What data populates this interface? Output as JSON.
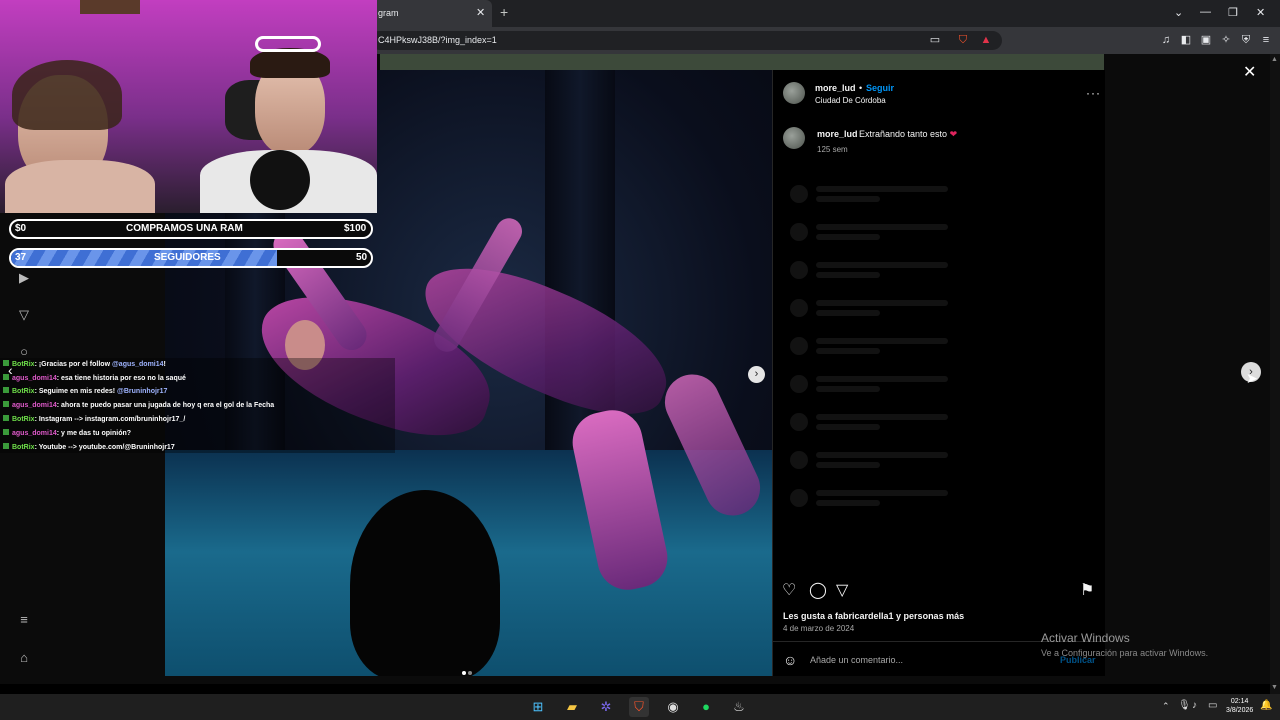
{
  "browser": {
    "tab_title": "gram",
    "url": "C4HPkswJ38B/?img_index=1"
  },
  "post": {
    "username": "more_lud",
    "follow": "Seguir",
    "location": "Ciudad De Córdoba",
    "caption_user": "more_lud",
    "caption_text": "Extrañando tanto esto",
    "caption_emoji": "❤",
    "caption_time": "125 sem",
    "likes": "Les gusta a fabricardella1 y personas más",
    "date": "4 de marzo de 2024",
    "comment_placeholder": "Añade un comentario...",
    "publish": "Publicar"
  },
  "stream": {
    "goal_left": "$0",
    "goal_title": "COMPRAMOS UNA RAM",
    "goal_right": "$100",
    "followers_current": "37",
    "followers_title": "SEGUIDORES",
    "followers_target": "50",
    "followers_progress": 0.74,
    "chat": [
      {
        "user": "BotRix",
        "msg": ": ¡Gracias por el follow ",
        "mention": "@agus_domi14",
        "end": "!",
        "style": "u1"
      },
      {
        "user": "agus_domi14",
        "msg": ": esa tiene historia por eso no la saqué",
        "mention": "",
        "end": "",
        "style": "u2"
      },
      {
        "user": "BotRix",
        "msg": ": Seguime en mis redes! ",
        "mention": "@Bruninhojr17",
        "end": "",
        "style": "u1"
      },
      {
        "user": "agus_domi14",
        "msg": ": ahora te puedo pasar una jugada de hoy q era el gol de la Fecha",
        "mention": "",
        "end": "",
        "style": "u2"
      },
      {
        "user": "BotRix",
        "msg": ": Instagram --> instagram.com/bruninhojr17_/",
        "mention": "",
        "end": "",
        "style": "u1"
      },
      {
        "user": "agus_domi14",
        "msg": ": y me das tu opinión?",
        "mention": "",
        "end": "",
        "style": "u2"
      },
      {
        "user": "BotRix",
        "msg": ": Youtube --> youtube.com/@Bruninhojr17",
        "mention": "",
        "end": "",
        "style": "u1"
      }
    ]
  },
  "watermark": {
    "line1": "Activar Windows",
    "line2": "Ve a Configuración para activar Windows."
  },
  "taskbar": {
    "time": "02:14",
    "date": "3/8/2026"
  }
}
